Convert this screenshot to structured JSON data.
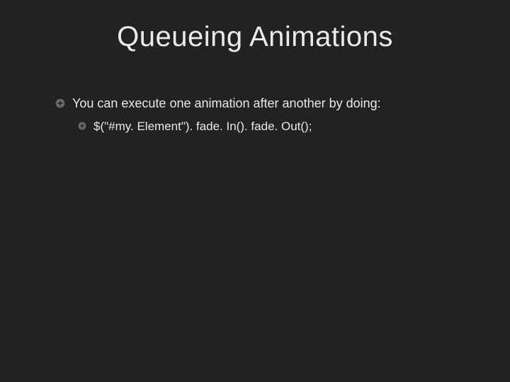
{
  "slide": {
    "title": "Queueing Animations",
    "bullets": [
      {
        "text": "You can execute one animation after another by doing:",
        "sub": [
          {
            "text": "$(\"#my. Element\"). fade. In(). fade. Out();"
          }
        ]
      }
    ]
  }
}
